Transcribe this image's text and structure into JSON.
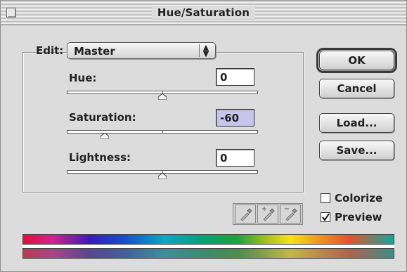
{
  "window": {
    "title": "Hue/Saturation"
  },
  "edit": {
    "label": "Edit:",
    "selected": "Master"
  },
  "sliders": {
    "hue": {
      "label": "Hue:",
      "value": "0",
      "position": 0.5
    },
    "saturation": {
      "label": "Saturation:",
      "value": "-60",
      "position": 0.2
    },
    "lightness": {
      "label": "Lightness:",
      "value": "0",
      "position": 0.5
    }
  },
  "buttons": {
    "ok": "OK",
    "cancel": "Cancel",
    "load": "Load...",
    "save": "Save..."
  },
  "options": {
    "colorize": {
      "label": "Colorize",
      "checked": false
    },
    "preview": {
      "label": "Preview",
      "checked": true
    }
  },
  "icons": [
    "eyedropper-icon",
    "eyedropper-plus-icon",
    "eyedropper-minus-icon",
    "chevron-up-down-icon",
    "close-box-icon",
    "slider-thumb-icon",
    "checkmark-icon"
  ]
}
